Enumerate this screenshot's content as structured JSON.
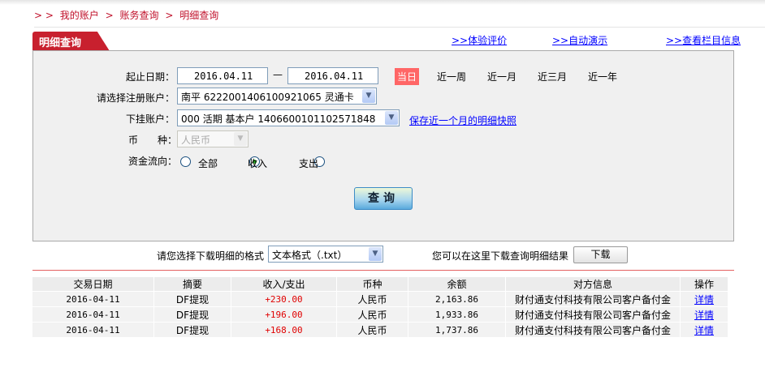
{
  "breadcrumb": {
    "items": [
      "> >",
      "我的账户",
      ">",
      "账务查询",
      ">",
      "明细查询"
    ]
  },
  "tab": {
    "title": "明细查询"
  },
  "top_links": [
    ">>体验评价",
    ">>自动演示",
    ">>查看栏目信息"
  ],
  "form": {
    "date_label": "起止日期：",
    "start_date": "2016.04.11",
    "dash": "—",
    "end_date": "2016.04.11",
    "quick_ranges": [
      "当日",
      "近一周",
      "近一月",
      "近三月",
      "近一年"
    ],
    "quick_selected": "当日",
    "account_label": "请选择注册账户：",
    "account_value": "南平 6222001406100921065 灵通卡",
    "sub_account_label": "下挂账户：",
    "sub_account_value": "000 活期 基本户 1406600101102571848",
    "snapshot_link": "保存近一个月的明细快照",
    "currency_label": "币　　种：",
    "currency_value": "人民币",
    "flow_label": "资金流向：",
    "flow_options": [
      "全部",
      "收入",
      "支出"
    ],
    "flow_selected": "收入",
    "query_button": "查询"
  },
  "download": {
    "format_label": "请您选择下载明细的格式",
    "format_value": "文本格式（.txt）",
    "hint": "您可以在这里下载查询明细结果",
    "button": "下载"
  },
  "table": {
    "headers": [
      "交易日期",
      "摘要",
      "收入/支出",
      "币种",
      "余额",
      "对方信息",
      "操作"
    ],
    "rows": [
      [
        "2016-04-11",
        "DF提现",
        "+230.00",
        "人民币",
        "2,163.86",
        "财付通支付科技有限公司客户备付金",
        "详情"
      ],
      [
        "2016-04-11",
        "DF提现",
        "+196.00",
        "人民币",
        "1,933.86",
        "财付通支付科技有限公司客户备付金",
        "详情"
      ],
      [
        "2016-04-11",
        "DF提现",
        "+168.00",
        "人民币",
        "1,737.86",
        "财付通支付科技有限公司客户备付金",
        "详情"
      ]
    ]
  },
  "colors": {
    "brand_red": "#c8202e",
    "amount_red": "#e00000",
    "link": "#0000ff",
    "today_bg": "#ff6666"
  }
}
